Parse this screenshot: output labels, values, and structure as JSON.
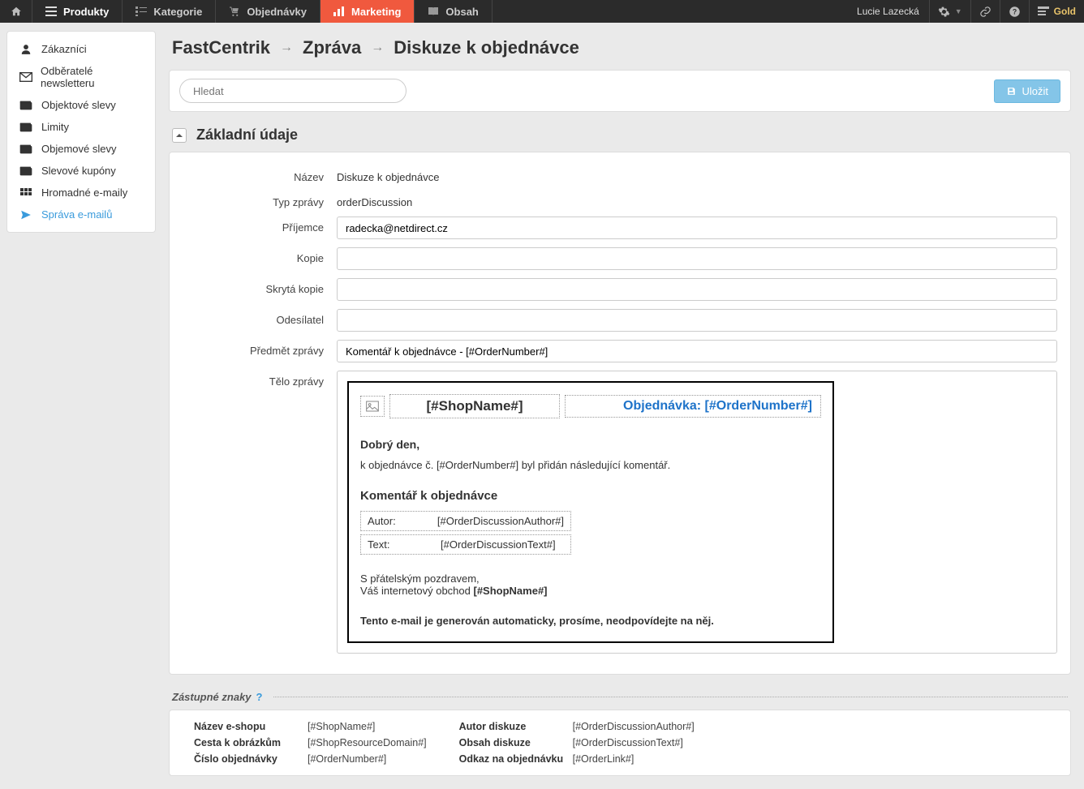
{
  "topnav": {
    "items": [
      {
        "label": "Produkty",
        "icon": "grid"
      },
      {
        "label": "Kategorie",
        "icon": "list"
      },
      {
        "label": "Objednávky",
        "icon": "cart"
      },
      {
        "label": "Marketing",
        "icon": "chart"
      },
      {
        "label": "Obsah",
        "icon": "book"
      }
    ]
  },
  "user": {
    "name": "Lucie Lazecká",
    "plan": "Gold"
  },
  "sidebar": {
    "items": [
      {
        "label": "Zákazníci"
      },
      {
        "label": "Odběratelé newsletteru"
      },
      {
        "label": "Objektové slevy"
      },
      {
        "label": "Limity"
      },
      {
        "label": "Objemové slevy"
      },
      {
        "label": "Slevové kupóny"
      },
      {
        "label": "Hromadné e-maily"
      },
      {
        "label": "Správa e-mailů"
      }
    ]
  },
  "breadcrumb": {
    "seg1": "FastCentrik",
    "seg2": "Zpráva",
    "seg3": "Diskuze k objednávce"
  },
  "toolbar": {
    "search_placeholder": "Hledat",
    "save_label": "Uložit"
  },
  "section": {
    "title": "Základní údaje"
  },
  "form": {
    "labels": {
      "name": "Název",
      "type": "Typ zprávy",
      "recipient": "Příjemce",
      "cc": "Kopie",
      "bcc": "Skrytá kopie",
      "sender": "Odesílatel",
      "subject": "Předmět zprávy",
      "body": "Tělo zprávy"
    },
    "values": {
      "name": "Diskuze k objednávce",
      "type": "orderDiscussion",
      "recipient": "radecka@netdirect.cz",
      "cc": "",
      "bcc": "",
      "sender": "",
      "subject": "Komentář k objednávce - [#OrderNumber#]"
    }
  },
  "emailBody": {
    "shopName": "[#ShopName#]",
    "orderHeaderPrefix": "Objednávka: ",
    "orderHeaderToken": "[#OrderNumber#]",
    "greeting": "Dobrý den,",
    "intro": "k objednávce č. [#OrderNumber#] byl přidán následující komentář.",
    "commentHeader": "Komentář k objednávce",
    "authorLabel": "Autor:",
    "authorValue": "[#OrderDiscussionAuthor#]",
    "textLabel": "Text:",
    "textValue": "[#OrderDiscussionText#]",
    "sign1": "S přátelským pozdravem,",
    "sign2a": "Váš internetový obchod ",
    "sign2b": "[#ShopName#]",
    "disclaimer": "Tento e-mail je generován automaticky, prosíme, neodpovídejte na něj."
  },
  "placeholders": {
    "header": "Zástupné znaky",
    "col1": {
      "labels": [
        "Název e-shopu",
        "Cesta k obrázkům",
        "Číslo objednávky"
      ],
      "values": [
        "[#ShopName#]",
        "[#ShopResourceDomain#]",
        "[#OrderNumber#]"
      ]
    },
    "col2": {
      "labels": [
        "Autor diskuze",
        "Obsah diskuze",
        "Odkaz na objednávku"
      ],
      "values": [
        "[#OrderDiscussionAuthor#]",
        "[#OrderDiscussionText#]",
        "[#OrderLink#]"
      ]
    }
  }
}
